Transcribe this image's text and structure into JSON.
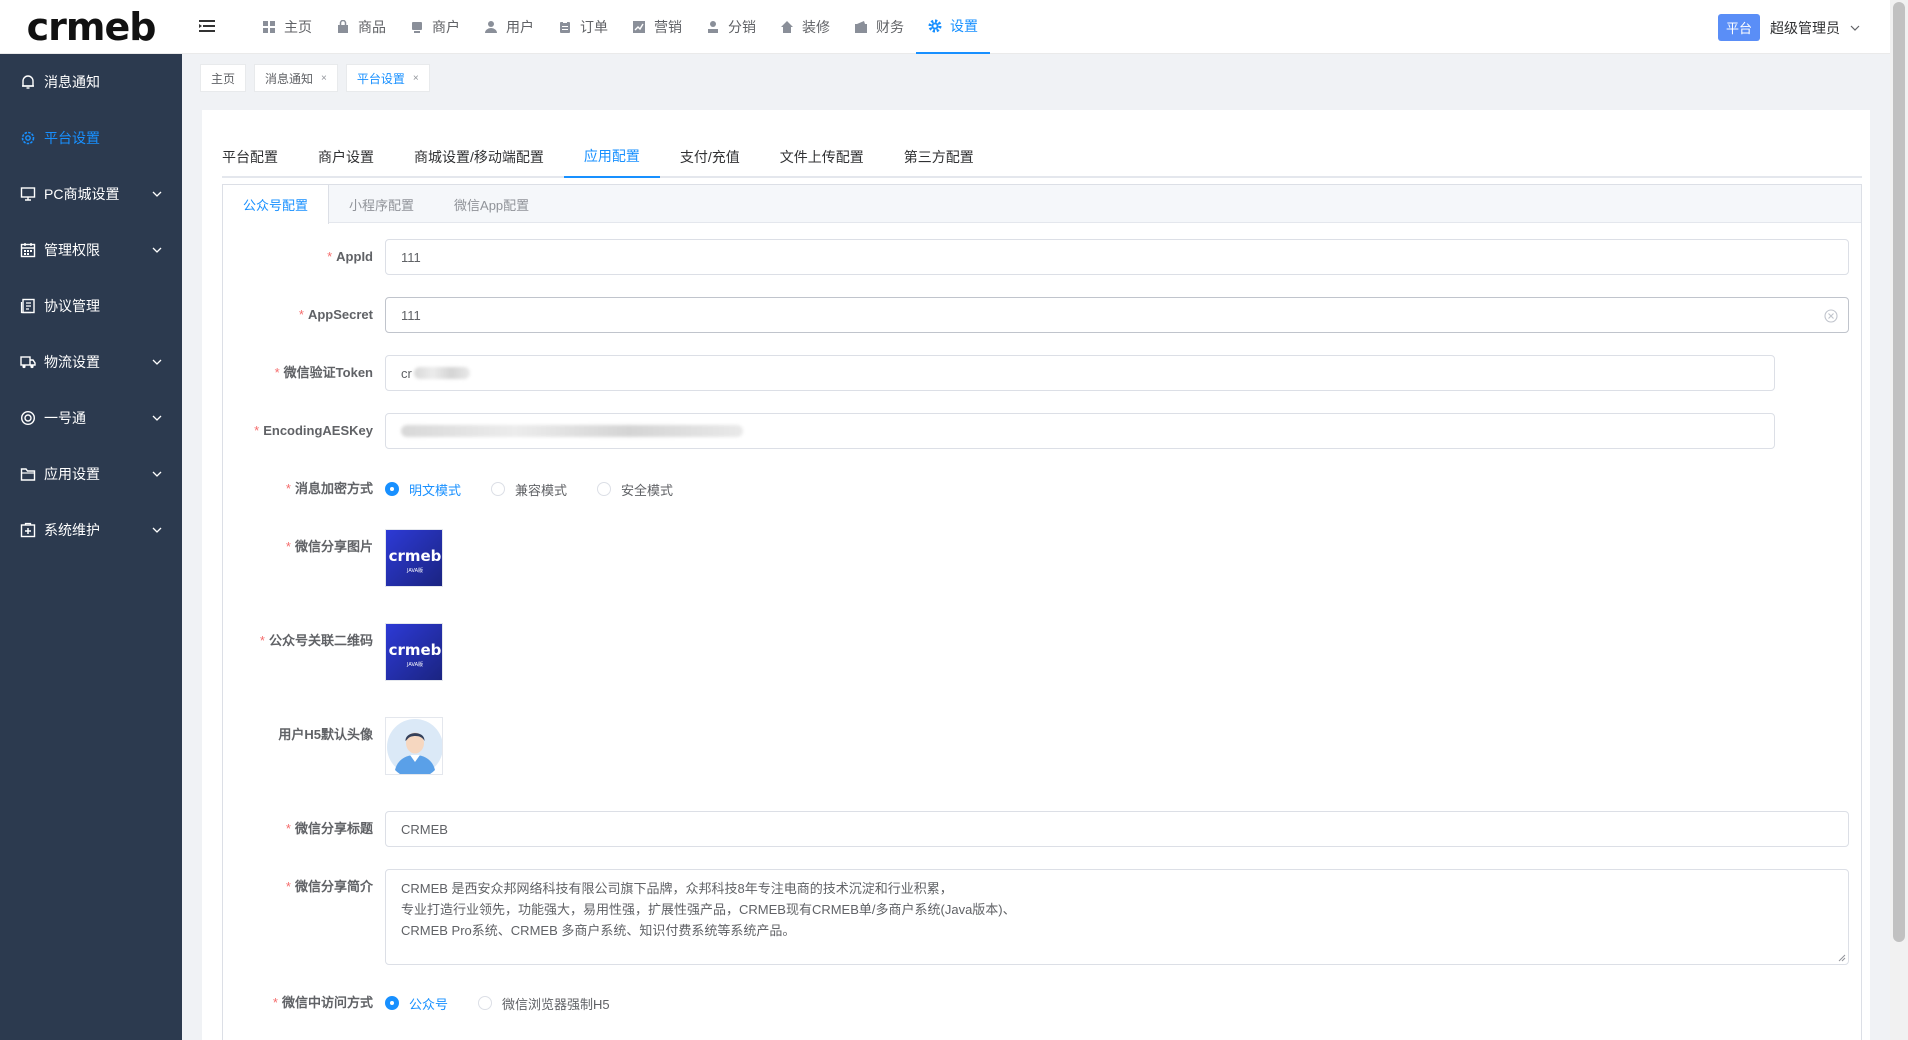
{
  "header": {
    "logo": "crmeb",
    "nav": [
      {
        "label": "主页",
        "icon": "dashboard-icon"
      },
      {
        "label": "商品",
        "icon": "bag-icon"
      },
      {
        "label": "商户",
        "icon": "store-icon"
      },
      {
        "label": "用户",
        "icon": "user-icon"
      },
      {
        "label": "订单",
        "icon": "clipboard-icon"
      },
      {
        "label": "营销",
        "icon": "chart-icon"
      },
      {
        "label": "分销",
        "icon": "person-icon"
      },
      {
        "label": "装修",
        "icon": "home-icon"
      },
      {
        "label": "财务",
        "icon": "wallet-icon"
      },
      {
        "label": "设置",
        "icon": "gear-icon",
        "active": true
      }
    ],
    "badge": "平台",
    "admin": "超级管理员"
  },
  "sidebar": {
    "items": [
      {
        "label": "消息通知",
        "icon": "bell-icon"
      },
      {
        "label": "平台设置",
        "icon": "settings-icon",
        "active": true
      },
      {
        "label": "PC商城设置",
        "icon": "monitor-icon",
        "expandable": true
      },
      {
        "label": "管理权限",
        "icon": "calendar-icon",
        "expandable": true
      },
      {
        "label": "协议管理",
        "icon": "document-icon"
      },
      {
        "label": "物流设置",
        "icon": "truck-icon",
        "expandable": true
      },
      {
        "label": "一号通",
        "icon": "lifebuoy-icon",
        "expandable": true
      },
      {
        "label": "应用设置",
        "icon": "folder-icon",
        "expandable": true
      },
      {
        "label": "系统维护",
        "icon": "maintenance-icon",
        "expandable": true
      }
    ]
  },
  "tags": [
    {
      "label": "主页",
      "closable": false
    },
    {
      "label": "消息通知",
      "closable": true
    },
    {
      "label": "平台设置",
      "closable": true,
      "active": true
    }
  ],
  "tabs": [
    "平台配置",
    "商户设置",
    "商城设置/移动端配置",
    "应用配置",
    "支付/充值",
    "文件上传配置",
    "第三方配置"
  ],
  "active_tab": "应用配置",
  "subtabs": [
    "公众号配置",
    "小程序配置",
    "微信App配置"
  ],
  "active_subtab": "公众号配置",
  "form": {
    "appid": {
      "label": "AppId",
      "value": "111"
    },
    "appsecret": {
      "label": "AppSecret",
      "value": "111"
    },
    "token": {
      "label": "微信验证Token",
      "value_prefix": "cr"
    },
    "aeskey": {
      "label": "EncodingAESKey"
    },
    "encrypt": {
      "label": "消息加密方式",
      "options": [
        "明文模式",
        "兼容模式",
        "安全模式"
      ],
      "selected": 0
    },
    "share_image": {
      "label": "微信分享图片",
      "logo_text": "crmeb",
      "logo_sub": "JAVA版"
    },
    "qrcode": {
      "label": "公众号关联二维码",
      "logo_text": "crmeb",
      "logo_sub": "JAVA版"
    },
    "avatar": {
      "label": "用户H5默认头像"
    },
    "share_title": {
      "label": "微信分享标题",
      "value": "CRMEB"
    },
    "share_intro": {
      "label": "微信分享简介",
      "lines": [
        "CRMEB 是西安众邦网络科技有限公司旗下品牌，众邦科技8年专注电商的技术沉淀和行业积累，",
        "专业打造行业领先，功能强大，易用性强，扩展性强产品，CRMEB现有CRMEB单/多商户系统(Java版本)、",
        "CRMEB Pro系统、CRMEB 多商户系统、知识付费系统等系统产品。"
      ]
    },
    "access_mode": {
      "label": "微信中访问方式",
      "options": [
        "公众号",
        "微信浏览器强制H5"
      ],
      "selected": 0
    }
  },
  "colors": {
    "primary": "#1890ff",
    "sidebar": "#2c3a4f",
    "required": "#f56c6c",
    "badge": "#5a8ef7"
  }
}
